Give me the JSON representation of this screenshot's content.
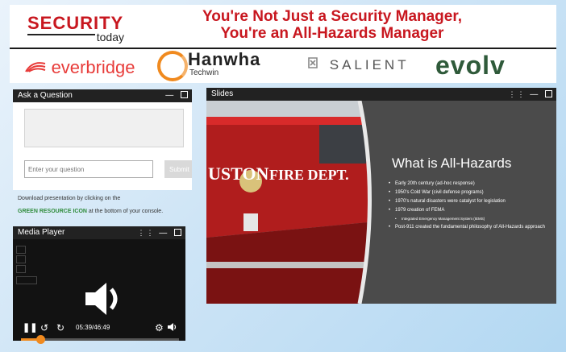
{
  "header": {
    "logo_line1": "SECURITY",
    "logo_line2": "today",
    "headline_line1": "You're Not Just a Security Manager,",
    "headline_line2": "You're an All-Hazards Manager"
  },
  "sponsors": {
    "everbridge": "everbridge",
    "hanwha_name": "Hanwha",
    "hanwha_sub": "Techwin",
    "salient": "SALIENT",
    "evolv": "evolv"
  },
  "ask": {
    "title": "Ask a Question",
    "input_placeholder": "Enter your question",
    "submit_label": "Submit",
    "download_line1": "Download presentation by clicking on the",
    "download_green": "GREEN RESOURCE ICON",
    "download_line2": " at the bottom of your console."
  },
  "media": {
    "title": "Media Player",
    "time": "05:39/46:49",
    "progress": 0.12
  },
  "slides": {
    "title": "Slides",
    "slide_heading": "What is All-Hazards",
    "truck_text_left": "USTON",
    "truck_text_right": "FIRE DEPT.",
    "bullets": [
      {
        "text": "Early 20th century (ad-hoc response)",
        "sub": false
      },
      {
        "text": "1950's Cold War (civil defense programs)",
        "sub": false
      },
      {
        "text": "1970's natural disasters were catalyst for legislation",
        "sub": false
      },
      {
        "text": "1979 creation of FEMA",
        "sub": false
      },
      {
        "text": "Integrated Emergency Management System (IEMS)",
        "sub": true
      },
      {
        "text": "Post-911 created the fundamental philosophy of All-Hazards approach",
        "sub": false
      }
    ]
  },
  "colors": {
    "brand_red": "#c8171f",
    "accent_orange": "#f08a1f",
    "resource_green": "#2e8b3a"
  }
}
